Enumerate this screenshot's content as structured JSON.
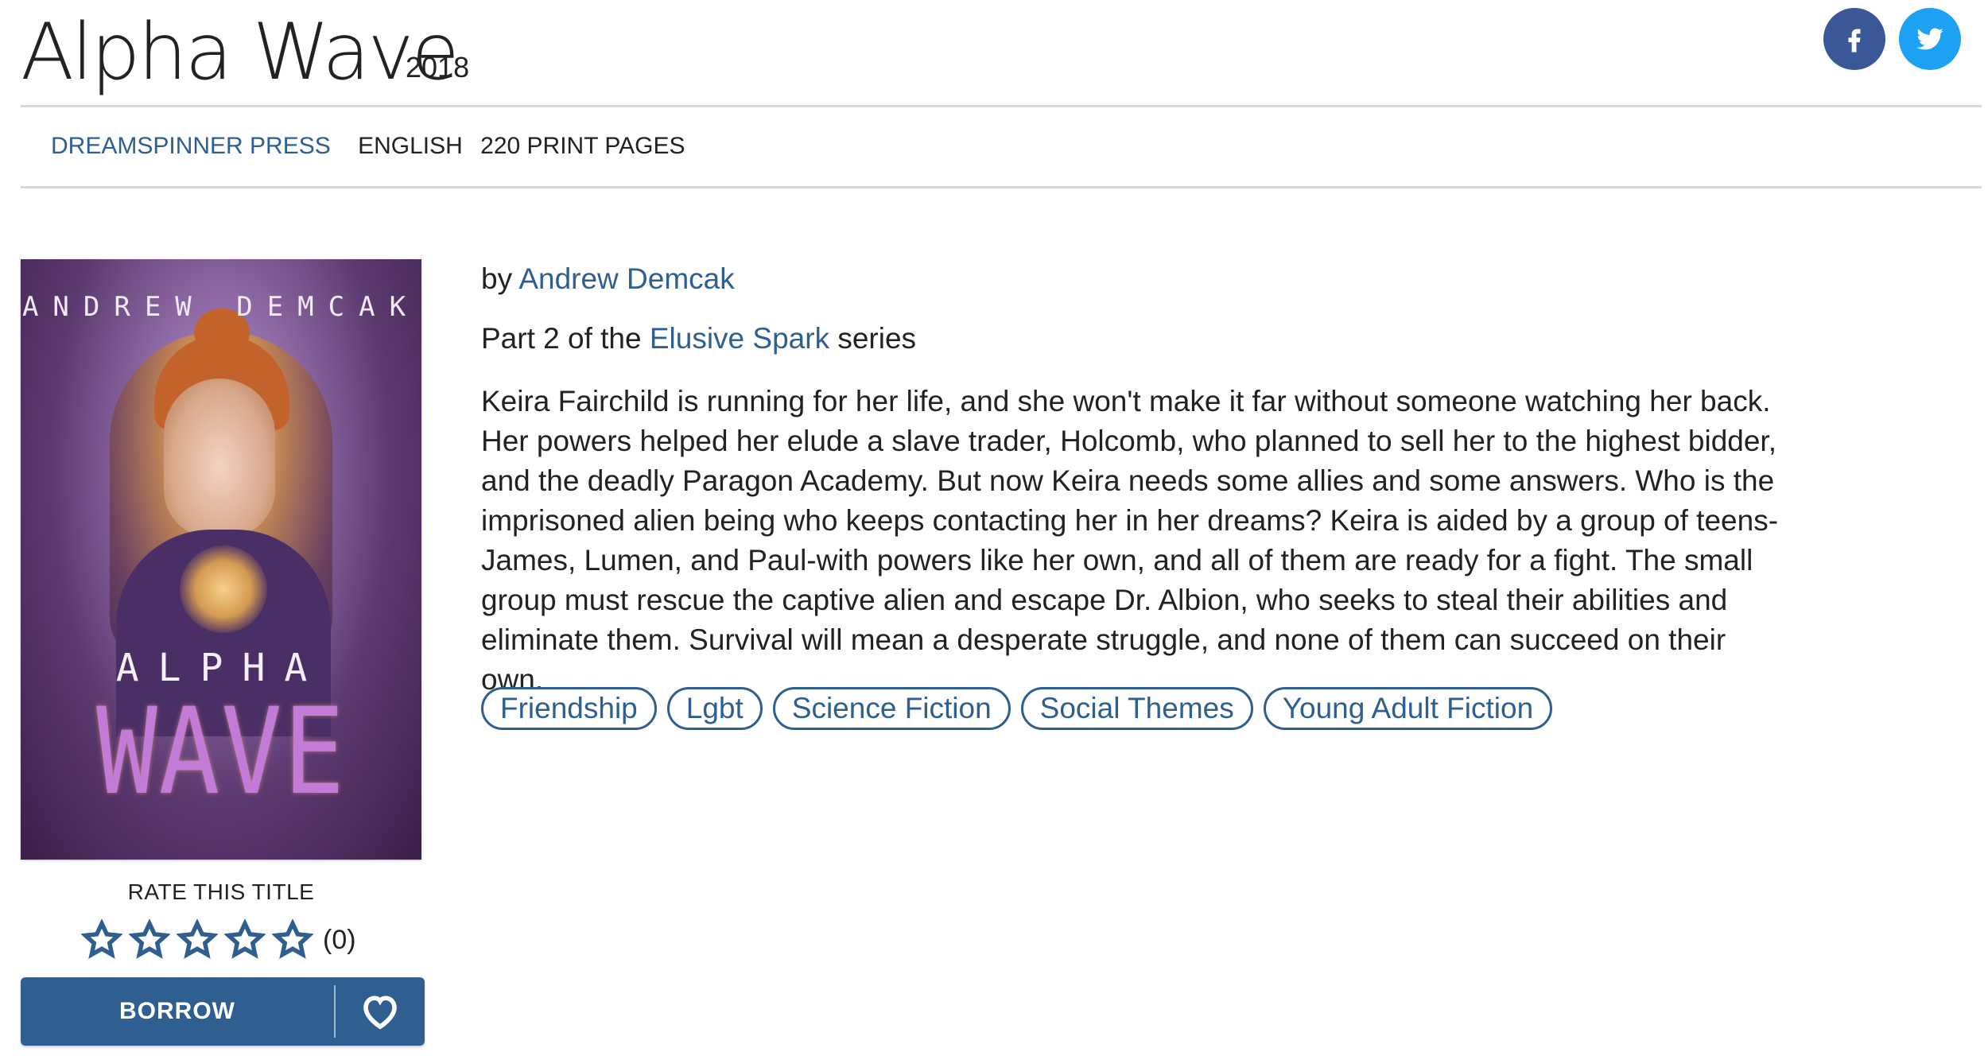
{
  "book": {
    "title": "Alpha Wave",
    "year": "2018",
    "publisher": "DREAMSPINNER PRESS",
    "language": "ENGLISH",
    "pages": "220 PRINT PAGES",
    "by_prefix": "by",
    "author": "Andrew Demcak",
    "series_prefix": "Part 2 of the",
    "series_name": "Elusive Spark",
    "series_suffix": "series",
    "description": "Keira Fairchild is running for her life, and she won't make it far without someone watching her back. Her powers helped her elude a slave trader, Holcomb, who planned to sell her to the highest bidder, and the deadly Paragon Academy. But now Keira needs some allies and some answers. Who is the imprisoned alien being who keeps contacting her in her dreams? Keira is aided by a group of teens-James, Lumen, and Paul-with powers like her own, and all of them are ready for a fight. The small group must rescue the captive alien and escape Dr. Albion, who seeks to steal their abilities and eliminate them. Survival will mean a desperate struggle, and none of them can succeed on their own."
  },
  "cover": {
    "author_text": "ANDREW DEMCAK",
    "title_line1": "ALPHA",
    "title_line2": "WAVE"
  },
  "tags": [
    "Friendship",
    "Lgbt",
    "Science Fiction",
    "Social Themes",
    "Young Adult Fiction"
  ],
  "rating": {
    "label": "RATE THIS TITLE",
    "count": "(0)",
    "stars": 5,
    "value": 0
  },
  "actions": {
    "borrow_label": "BORROW",
    "wishlist_icon": "heart-icon"
  },
  "social": {
    "facebook_icon": "facebook-icon",
    "twitter_icon": "twitter-icon"
  },
  "colors": {
    "link": "#2f5f91",
    "facebook": "#3a5897",
    "twitter": "#1da1f2",
    "button": "#2f5f91"
  }
}
